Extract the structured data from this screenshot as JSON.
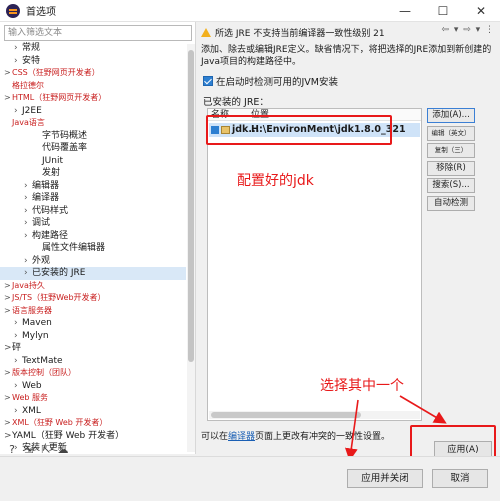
{
  "window": {
    "title": "首选项",
    "minimize": "—",
    "maximize": "☐",
    "close": "✕"
  },
  "left": {
    "filter_placeholder": "输入筛选文本",
    "tree": [
      {
        "twisty": "›",
        "label": "常规",
        "indent": 1
      },
      {
        "twisty": "›",
        "label": "安特",
        "indent": 1
      },
      {
        "twisty": ">",
        "label": "CSS（狂野网页开发者）",
        "indent": 0,
        "small": true
      },
      {
        "twisty": "",
        "label": "格拉德尔",
        "indent": 0,
        "small": true
      },
      {
        "twisty": ">",
        "label": "HTML（狂野网页开发者）",
        "indent": 0,
        "small": true
      },
      {
        "twisty": "›",
        "label": "J2EE",
        "indent": 1
      },
      {
        "twisty": "",
        "label": "Java语言",
        "indent": 0,
        "small": true
      },
      {
        "twisty": "",
        "label": "字节码概述",
        "indent": 3
      },
      {
        "twisty": "",
        "label": "代码覆盖率",
        "indent": 3
      },
      {
        "twisty": "",
        "label": "JUnit",
        "indent": 3
      },
      {
        "twisty": "",
        "label": "发射",
        "indent": 3
      },
      {
        "twisty": "›",
        "label": "编辑器",
        "indent": 2
      },
      {
        "twisty": "›",
        "label": "编译器",
        "indent": 2
      },
      {
        "twisty": "›",
        "label": "代码样式",
        "indent": 2
      },
      {
        "twisty": "›",
        "label": "调试",
        "indent": 2
      },
      {
        "twisty": "›",
        "label": "构建路径",
        "indent": 2
      },
      {
        "twisty": "",
        "label": "属性文件编辑器",
        "indent": 3
      },
      {
        "twisty": "›",
        "label": "外观",
        "indent": 2
      },
      {
        "twisty": "›",
        "label": "已安装的 JRE",
        "indent": 2,
        "selected": true
      },
      {
        "twisty": ">",
        "label": "Java持久",
        "indent": 0,
        "small": true
      },
      {
        "twisty": ">",
        "label": "JS/TS（狂野Web开发者）",
        "indent": 0,
        "small": true
      },
      {
        "twisty": ">",
        "label": "语言服务器",
        "indent": 0,
        "small": true
      },
      {
        "twisty": "›",
        "label": "Maven",
        "indent": 1
      },
      {
        "twisty": "›",
        "label": "Mylyn",
        "indent": 1
      },
      {
        "twisty": ">",
        "label": "砰",
        "indent": 0
      },
      {
        "twisty": "›",
        "label": "TextMate",
        "indent": 1
      },
      {
        "twisty": ">",
        "label": "版本控制（团队）",
        "indent": 0,
        "small": true
      },
      {
        "twisty": "›",
        "label": "Web",
        "indent": 1
      },
      {
        "twisty": ">",
        "label": "Web 服务",
        "indent": 0,
        "small": true
      },
      {
        "twisty": "›",
        "label": "XML",
        "indent": 1
      },
      {
        "twisty": ">",
        "label": "XML（狂野 Web 开发者）",
        "indent": 0,
        "small": true
      },
      {
        "twisty": ">",
        "label": "YAML（狂野 Web 开发者）",
        "indent": 0
      },
      {
        "twisty": "›",
        "label": "安装 / 更新",
        "indent": 1
      }
    ]
  },
  "right": {
    "warning": "所选 JRE 不支持当前编译器一致性级别 21",
    "nav": "⇦ ▾ ⇨ ▾ ⋮",
    "description": "添加、除去或编辑JRE定义。缺省情况下，将把选择的JRE添加到新创建的Java项目的构建路径中。",
    "detect_label": "在启动时检测可用的JVM安装",
    "installed_label": "已安装的 JRE：",
    "table": {
      "col_name": "名称",
      "col_location": "位置",
      "rows": [
        {
          "name": "jdk...",
          "location": "H:\\EnvironMent\\jdk1.8.0_321"
        }
      ]
    },
    "buttons": {
      "add": "添加(A)...",
      "edit": "编辑（英文）",
      "copy": "复制（三）",
      "remove": "移除(R)",
      "search": "搜索(S)...",
      "autodetect": "自动检测"
    },
    "link_prefix": "可以在",
    "link_text": "编译器",
    "link_suffix": "页面上更改有冲突的一致性设置。",
    "apply": "应用(A)"
  },
  "annotations": {
    "configured": "配置好的jdk",
    "select_one": "选择其中一个"
  },
  "footer": {
    "apply_close": "应用并关闭",
    "cancel": "取消"
  },
  "colors": {
    "annotation": "#e8191a",
    "selection": "#cfe3f8",
    "accent": "#2d7fd1"
  }
}
